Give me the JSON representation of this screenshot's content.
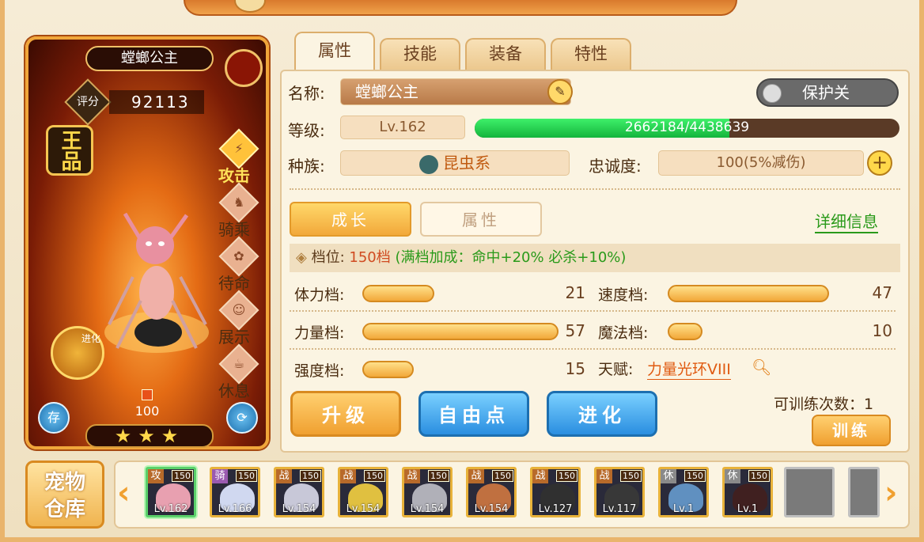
{
  "pet": {
    "name": "螳螂公主",
    "score_label": "评分",
    "score": "92113",
    "grade": "王品",
    "evolve_label": "进化",
    "loyalty_value": "100",
    "stars": 3
  },
  "side_actions": [
    {
      "label": "攻击",
      "icon": "attack-icon",
      "active": true
    },
    {
      "label": "骑乘",
      "icon": "ride-icon",
      "active": false
    },
    {
      "label": "待命",
      "icon": "standby-icon",
      "active": false
    },
    {
      "label": "展示",
      "icon": "display-icon",
      "active": false
    },
    {
      "label": "休息",
      "icon": "rest-icon",
      "active": false
    }
  ],
  "card_buttons": {
    "store_label": "存",
    "swap_label": "swap-icon"
  },
  "tabs": [
    {
      "label": "属性",
      "active": true
    },
    {
      "label": "技能",
      "active": false
    },
    {
      "label": "装备",
      "active": false
    },
    {
      "label": "特性",
      "active": false
    }
  ],
  "info": {
    "name_label": "名称:",
    "name_value": "螳螂公主",
    "protect_label": "保护关",
    "level_label": "等级:",
    "level_value": "Lv.162",
    "exp_text": "2662184/4438639",
    "exp_fraction": 0.5998,
    "race_label": "种族:",
    "race_value": "昆虫系",
    "loyalty_label": "忠诚度:",
    "loyalty_value": "100(5%减伤)"
  },
  "subtabs": {
    "growth": "成长",
    "attr": "属性",
    "detail": "详细信息"
  },
  "grade_line": {
    "prefix": "档位:",
    "value": "150档",
    "bonus": "(满档加成：命中+20% 必杀+10%)"
  },
  "stats": [
    {
      "name": "体力档:",
      "value": 21
    },
    {
      "name": "速度档:",
      "value": 47
    },
    {
      "name": "力量档:",
      "value": 57
    },
    {
      "name": "魔法档:",
      "value": 10
    },
    {
      "name": "强度档:",
      "value": 15
    }
  ],
  "talent": {
    "label": "天赋:",
    "value": "力量光环VIII"
  },
  "buttons": {
    "upgrade": "升级",
    "free_points": "自由点",
    "evolve": "进化",
    "train": "训练"
  },
  "train_count": "可训练次数：1",
  "storage_label": [
    "宠物",
    "仓库"
  ],
  "pet_list": [
    {
      "tag": "攻",
      "num": "150",
      "level": "Lv.162",
      "color": "#e8a0b0",
      "selected": true,
      "tag_type": "atk"
    },
    {
      "tag": "骑",
      "num": "150",
      "level": "Lv.166",
      "color": "#d0d8f0",
      "selected": false,
      "tag_type": "ride"
    },
    {
      "tag": "战",
      "num": "150",
      "level": "Lv.154",
      "color": "#c8c8d8",
      "selected": false,
      "tag_type": "atk"
    },
    {
      "tag": "战",
      "num": "150",
      "level": "Lv.154",
      "color": "#e0c040",
      "selected": false,
      "tag_type": "atk"
    },
    {
      "tag": "战",
      "num": "150",
      "level": "Lv.154",
      "color": "#b0b0b8",
      "selected": false,
      "tag_type": "atk"
    },
    {
      "tag": "战",
      "num": "150",
      "level": "Lv.154",
      "color": "#c07040",
      "selected": false,
      "tag_type": "atk"
    },
    {
      "tag": "战",
      "num": "150",
      "level": "Lv.127",
      "color": "#303030",
      "selected": false,
      "tag_type": "atk"
    },
    {
      "tag": "战",
      "num": "150",
      "level": "Lv.117",
      "color": "#383838",
      "selected": false,
      "tag_type": "atk"
    },
    {
      "tag": "休",
      "num": "150",
      "level": "Lv.1",
      "color": "#6090c0",
      "selected": false,
      "tag_type": "rest"
    },
    {
      "tag": "休",
      "num": "150",
      "level": "Lv.1",
      "color": "#402020",
      "selected": false,
      "tag_type": "rest"
    }
  ]
}
